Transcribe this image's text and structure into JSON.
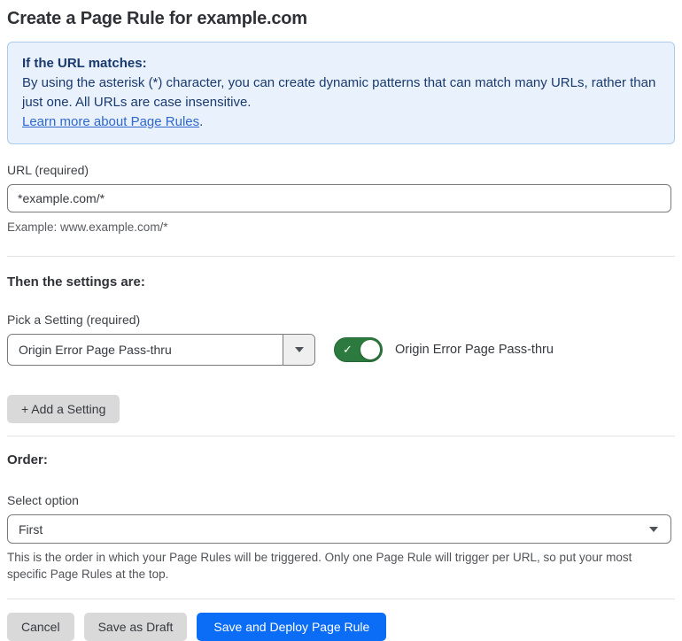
{
  "page": {
    "title": "Create a Page Rule for example.com"
  },
  "info_box": {
    "heading": "If the URL matches:",
    "body": "By using the asterisk (*) character, you can create dynamic patterns that can match many URLs, rather than just one. All URLs are case insensitive.",
    "link_label": "Learn more about Page Rules",
    "link_suffix": "."
  },
  "url_section": {
    "label": "URL (required)",
    "input_value": "*example.com/*",
    "helper": "Example: www.example.com/*"
  },
  "settings_section": {
    "heading": "Then the settings are:",
    "picker_label": "Pick a Setting (required)",
    "picker_value": "Origin Error Page Pass-thru",
    "toggle_state": "on",
    "toggle_check": "✓",
    "toggle_label": "Origin Error Page Pass-thru",
    "add_button_label": "+ Add a Setting"
  },
  "order_section": {
    "heading": "Order:",
    "select_label": "Select option",
    "select_value": "First",
    "helper": "This is the order in which your Page Rules will be triggered. Only one Page Rule will trigger per URL, so put your most specific Page Rules at the top."
  },
  "footer": {
    "cancel_label": "Cancel",
    "save_draft_label": "Save as Draft",
    "save_deploy_label": "Save and Deploy Page Rule"
  },
  "colors": {
    "accent_blue": "#0b6cf5",
    "toggle_green": "#2c7a3e",
    "info_bg": "#e9f2fc",
    "info_border": "#abccee",
    "info_text": "#1a3a6e",
    "link_blue": "#2f67cf",
    "button_gray": "#d9d9d9"
  }
}
